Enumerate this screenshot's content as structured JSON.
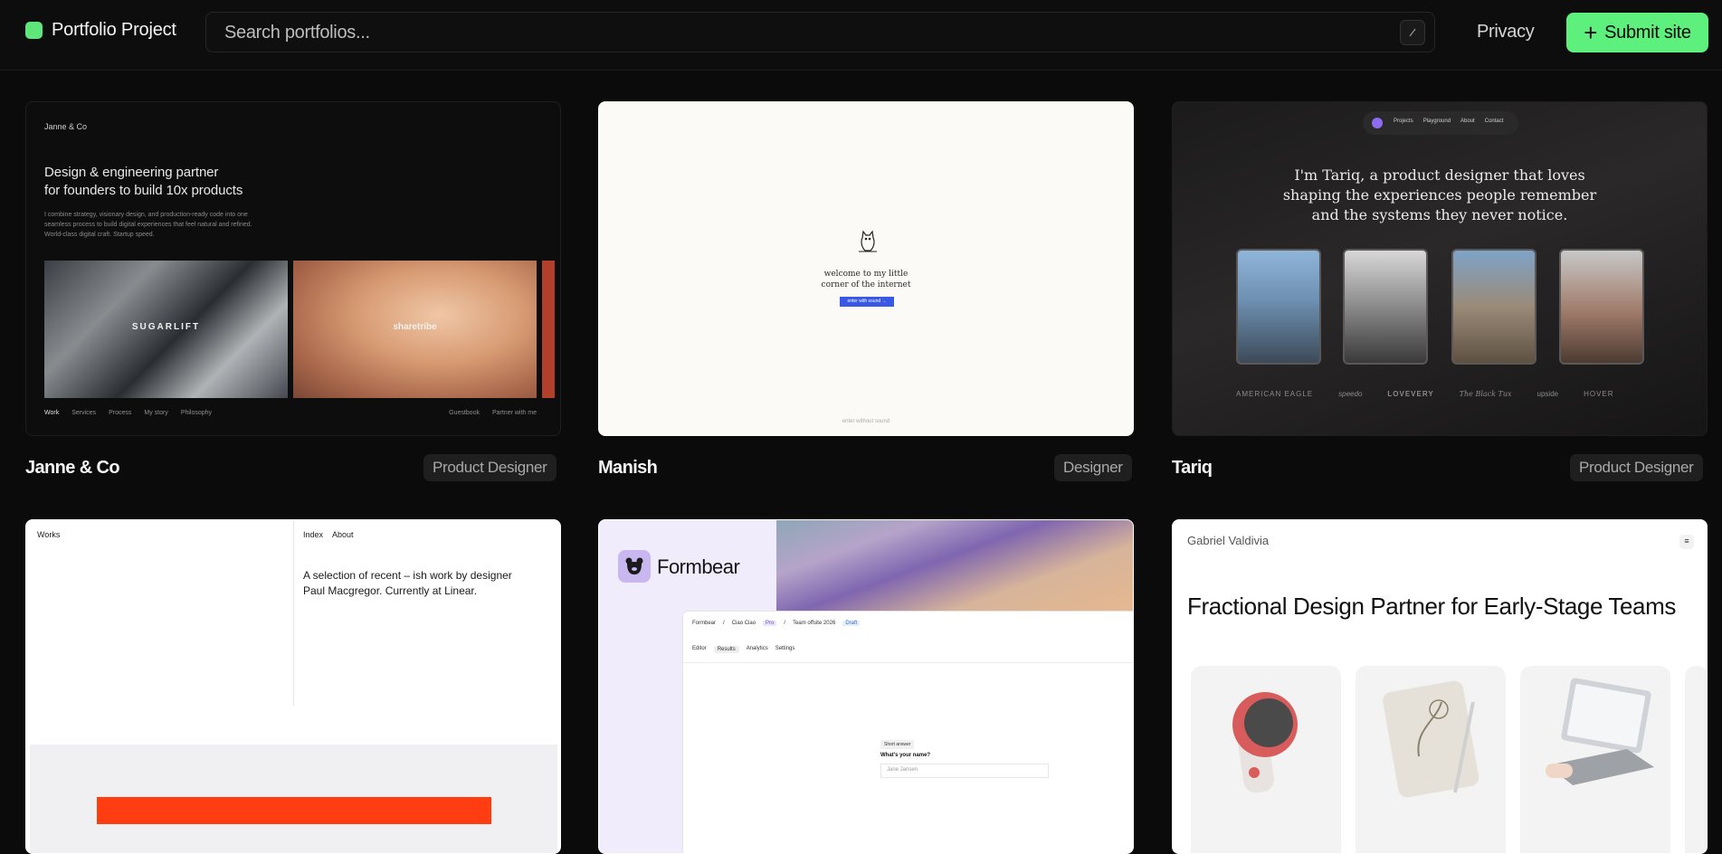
{
  "header": {
    "logo_text": "Portfolio Project",
    "search_placeholder": "Search portfolios...",
    "search_shortcut": "/",
    "privacy_label": "Privacy",
    "submit_label": "Submit site"
  },
  "colors": {
    "accent": "#5df07c",
    "background": "#0b0b0b"
  },
  "cards": [
    {
      "name": "Janne & Co",
      "tag": "Product Designer",
      "preview": {
        "brand": "Janne & Co",
        "headline_1": "Design & engineering partner",
        "headline_2": "for founders to build 10x products",
        "body_1": "I combine strategy, visionary design, and production-ready code into one",
        "body_2": "seamless process to build digital experiences that feel natural and refined.",
        "body_3": "World-class digital craft. Startup speed.",
        "image_1_label": "SUGARLIFT",
        "image_2_label": "sharetribe",
        "nav_left": [
          "Work",
          "Services",
          "Process",
          "My story",
          "Philosophy"
        ],
        "nav_right": [
          "Guestbook",
          "Partner with me"
        ]
      }
    },
    {
      "name": "Manish",
      "tag": "Designer",
      "preview": {
        "line_1": "welcome to my little",
        "line_2": "corner of the internet",
        "button": "enter with sound →",
        "footer": "enter without sound"
      }
    },
    {
      "name": "Tariq",
      "tag": "Product Designer",
      "preview": {
        "nav": [
          "Projects",
          "Playground",
          "About",
          "Contact"
        ],
        "headline_1": "I'm Tariq, a product designer that loves",
        "headline_2": "shaping the experiences people remember",
        "headline_3": "and the systems they never notice.",
        "logos": [
          "AMERICAN EAGLE",
          "speedo",
          "LOVEVERY",
          "The Black Tux",
          "upside",
          "HOVER"
        ]
      }
    },
    {
      "preview": {
        "works": "Works",
        "nav": [
          "Index",
          "About"
        ],
        "intro_1": "A selection of recent – ish work by designer",
        "intro_2": "Paul Macgregor. Currently at Linear."
      }
    },
    {
      "preview": {
        "brand": "Formbear",
        "crumb": [
          "Formbear",
          "/",
          "Ciao Ciao",
          "Pro",
          "/",
          "Team offsite 2026",
          "Draft"
        ],
        "tabs": [
          "Editor",
          "Results",
          "Analytics",
          "Settings"
        ],
        "question_tag": "Short answer",
        "question": "What's your name?",
        "answer_placeholder": "Jane Jansen"
      }
    },
    {
      "preview": {
        "name": "Gabriel Valdivia",
        "headline": "Fractional Design Partner for Early-Stage Teams"
      }
    }
  ]
}
